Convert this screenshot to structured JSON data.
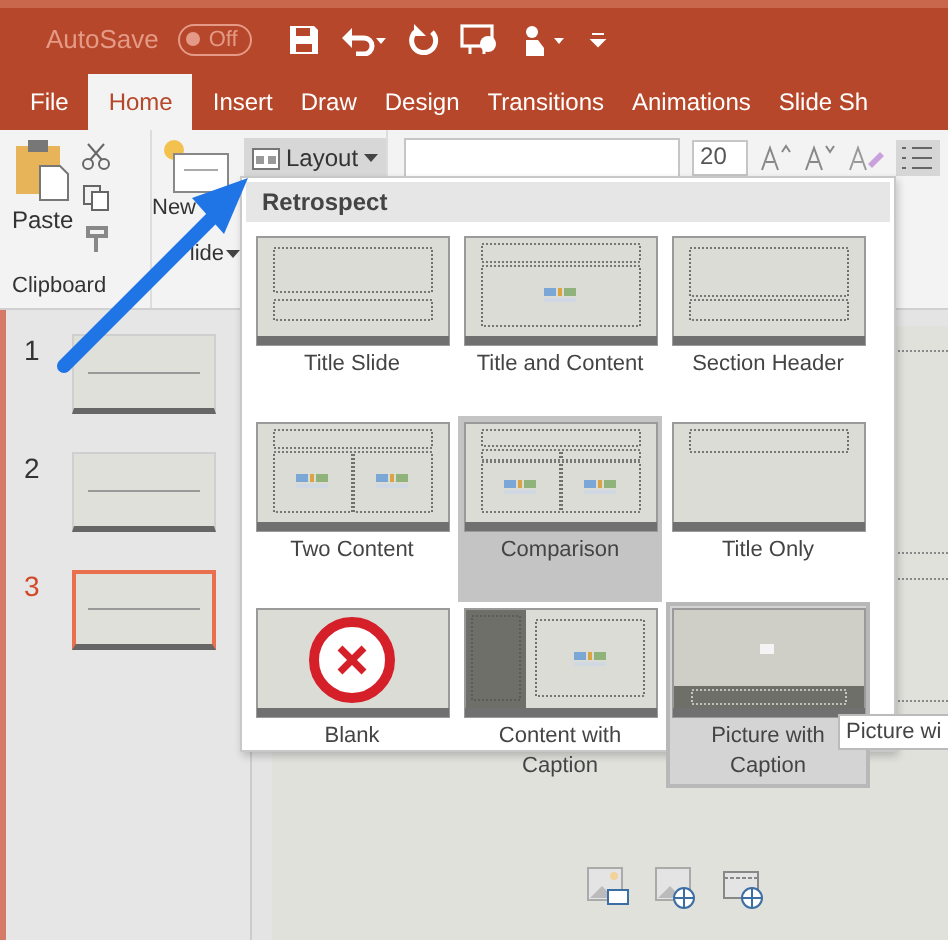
{
  "title_bar": {
    "autosave_label": "AutoSave",
    "autosave_toggle": {
      "label": "Off",
      "on": false
    }
  },
  "tabs": [
    {
      "label": "File",
      "selected": false
    },
    {
      "label": "Home",
      "selected": true
    },
    {
      "label": "Insert",
      "selected": false
    },
    {
      "label": "Draw",
      "selected": false
    },
    {
      "label": "Design",
      "selected": false
    },
    {
      "label": "Transitions",
      "selected": false
    },
    {
      "label": "Animations",
      "selected": false
    },
    {
      "label": "Slide Sh",
      "selected": false
    }
  ],
  "ribbon": {
    "paste": "Paste",
    "new_slide": [
      "New",
      "lide"
    ],
    "layout_button": "Layout",
    "font_size": "20",
    "clipboard_group": "Clipboard"
  },
  "slides": [
    {
      "number": "1",
      "selected": false
    },
    {
      "number": "2",
      "selected": false
    },
    {
      "number": "3",
      "selected": true
    }
  ],
  "layout_menu": {
    "header": "Retrospect",
    "items": [
      {
        "label": "Title Slide",
        "kind": "title",
        "selected": false,
        "hovered": false
      },
      {
        "label": "Title and Content",
        "kind": "title_content",
        "selected": false,
        "hovered": false
      },
      {
        "label": "Section Header",
        "kind": "section",
        "selected": false,
        "hovered": false
      },
      {
        "label": "Two Content",
        "kind": "two_content",
        "selected": false,
        "hovered": false
      },
      {
        "label": "Comparison",
        "kind": "comparison",
        "selected": true,
        "hovered": false
      },
      {
        "label": "Title Only",
        "kind": "title_only",
        "selected": false,
        "hovered": false
      },
      {
        "label": "Blank",
        "kind": "blank",
        "selected": false,
        "hovered": false
      },
      {
        "label": "Content with Caption",
        "kind": "content_caption",
        "selected": false,
        "hovered": false
      },
      {
        "label": "Picture with Caption",
        "kind": "picture_caption",
        "selected": false,
        "hovered": true
      }
    ]
  },
  "tooltip": "Picture wi"
}
